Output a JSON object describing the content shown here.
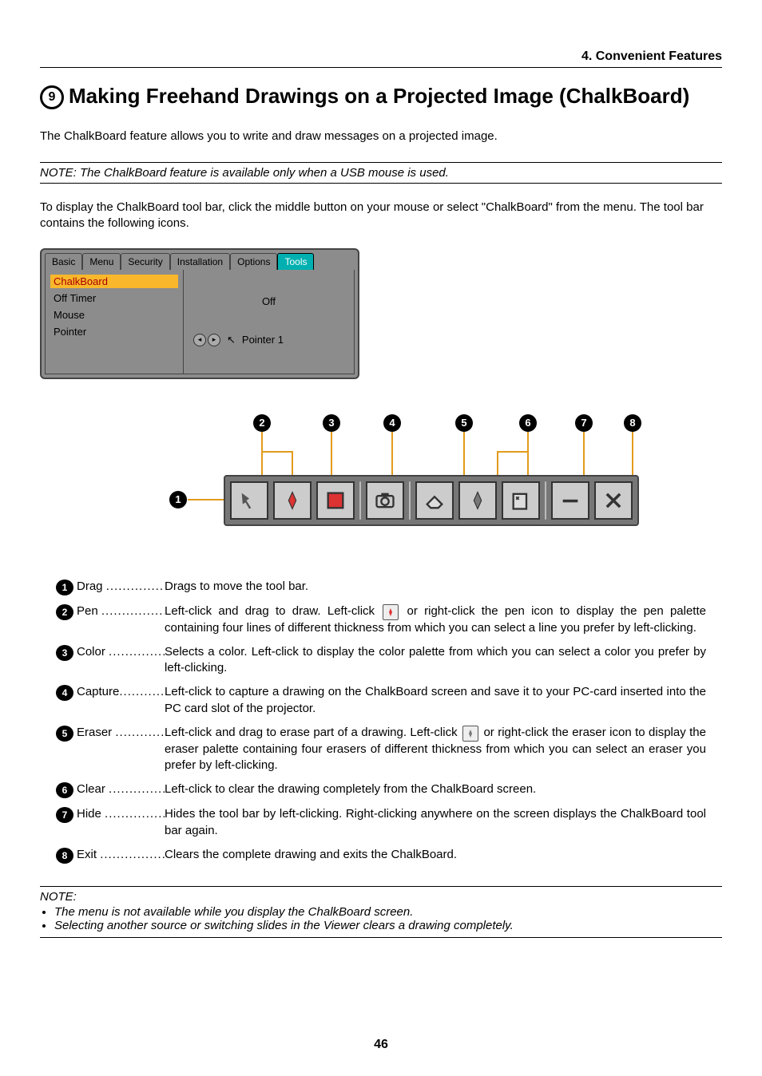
{
  "section_header": "4. Convenient Features",
  "title_number": "9",
  "title_text": "Making Freehand Drawings on a Projected Image (ChalkBoard)",
  "intro": "The ChalkBoard feature allows you to write and draw messages on a projected image.",
  "note1": "NOTE: The ChalkBoard feature is available only when a USB mouse is used.",
  "body1": "To display the ChalkBoard tool bar, click the middle button on your mouse or select \"ChalkBoard\" from the menu. The tool bar contains the following icons.",
  "menu": {
    "tabs": [
      "Basic",
      "Menu",
      "Security",
      "Installation",
      "Options",
      "Tools"
    ],
    "left": [
      "ChalkBoard",
      "Off Timer",
      "Mouse",
      "Pointer"
    ],
    "right_off": "Off",
    "right_pointer": "Pointer 1"
  },
  "items": [
    {
      "n": "1",
      "label": "Drag",
      "text": "Drags to move the tool bar."
    },
    {
      "n": "2",
      "label": "Pen",
      "text_a": "Left-click and drag to draw. Left-click ",
      "text_b": " or right-click the pen icon to display the pen palette containing four lines of different thickness from which you can select a line you prefer by left-clicking.",
      "has_icon": true
    },
    {
      "n": "3",
      "label": "Color",
      "text": "Selects a color. Left-click to display the color palette from which you can select a color you prefer by left-clicking."
    },
    {
      "n": "4",
      "label": "Capture",
      "text": "Left-click to capture a drawing on the ChalkBoard screen and save it to your PC-card inserted into the PC card slot of the projector."
    },
    {
      "n": "5",
      "label": "Eraser",
      "text_a": "Left-click and drag to erase part of a drawing. Left-click ",
      "text_b": " or right-click the eraser icon to display the eraser palette containing four erasers of different thickness from which you can select an eraser you prefer by left-clicking.",
      "has_icon": true
    },
    {
      "n": "6",
      "label": "Clear",
      "text": "Left-click to clear the drawing completely from the ChalkBoard screen."
    },
    {
      "n": "7",
      "label": "Hide",
      "text": "Hides the tool bar by left-clicking. Right-clicking anywhere on the screen displays the ChalkBoard tool bar again."
    },
    {
      "n": "8",
      "label": "Exit",
      "text": "Clears the complete drawing and exits the ChalkBoard."
    }
  ],
  "note2_label": "NOTE:",
  "note2_b1": "The menu is not available while you display the ChalkBoard screen.",
  "note2_b2": "Selecting another source or switching slides in the Viewer clears a drawing completely.",
  "page_number": "46"
}
